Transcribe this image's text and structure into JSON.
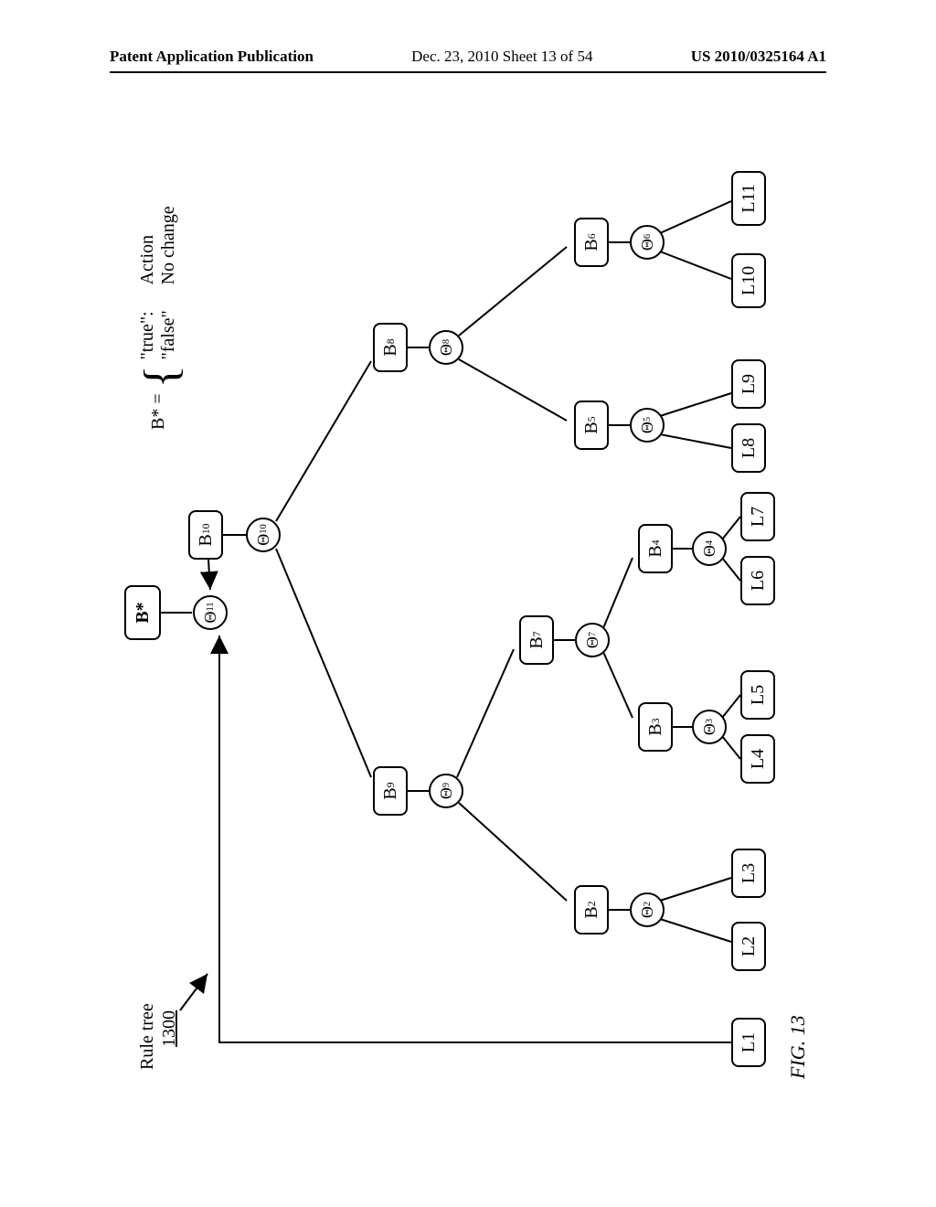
{
  "header": {
    "left": "Patent Application Publication",
    "mid": "Dec. 23, 2010  Sheet 13 of 54",
    "right": "US 2010/0325164 A1"
  },
  "labels": {
    "rule_tree_title": "Rule tree",
    "rule_tree_ref": "1300",
    "figure": "FIG. 13",
    "b_star": "B*",
    "b_star_eq_lhs": "B* =",
    "legend_true_key": "\"true\":",
    "legend_true_val": "Action",
    "legend_false_key": "\"false\"",
    "legend_false_val": "No change"
  },
  "nodes": {
    "B10": "B",
    "B10_sub": "10",
    "B9": "B",
    "B9_sub": "9",
    "B8": "B",
    "B8_sub": "8",
    "B7": "B",
    "B7_sub": "7",
    "B6": "B",
    "B6_sub": "6",
    "B5": "B",
    "B5_sub": "5",
    "B4": "B",
    "B4_sub": "4",
    "B3": "B",
    "B3_sub": "3",
    "B2": "B",
    "B2_sub": "2",
    "Th11_sub": "11",
    "Th10_sub": "10",
    "Th9_sub": "9",
    "Th8_sub": "8",
    "Th7_sub": "7",
    "Th6_sub": "6",
    "Th5_sub": "5",
    "Th4_sub": "4",
    "Th3_sub": "3",
    "Th2_sub": "2",
    "L1": "L1",
    "L2": "L2",
    "L3": "L3",
    "L4": "L4",
    "L5": "L5",
    "L6": "L6",
    "L7": "L7",
    "L8": "L8",
    "L9": "L9",
    "L10": "L10",
    "L11": "L11"
  }
}
